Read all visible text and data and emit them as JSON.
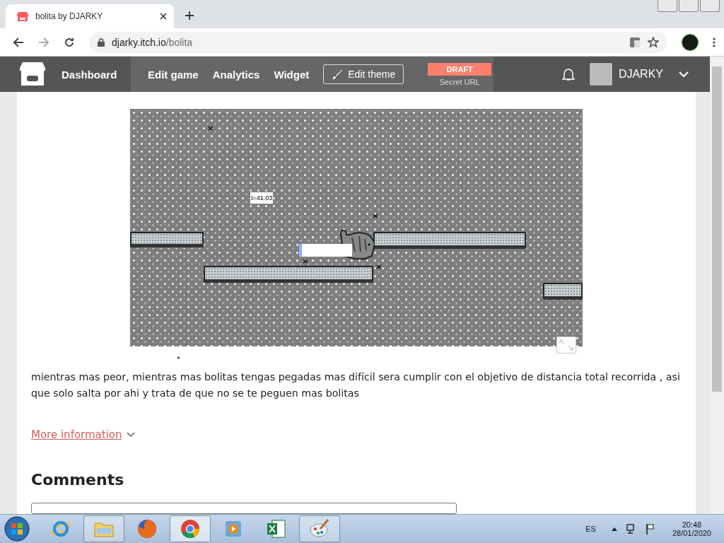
{
  "browser": {
    "tab_title": "bolita by DJARKY",
    "url_host": "djarky.itch.io",
    "url_path": "/bolita"
  },
  "itch_bar": {
    "dashboard": "Dashboard",
    "nav": [
      {
        "label": "Edit game"
      },
      {
        "label": "Analytics"
      },
      {
        "label": "Widget"
      }
    ],
    "edit_theme": "Edit theme",
    "draft": "DRAFT",
    "secret_url": "Secret URL",
    "username": "DJARKY"
  },
  "game": {
    "timer": "t=41.03"
  },
  "description": "mientras mas peor, mientras mas bolitas tengas pegadas mas difícil sera cumplir con el objetivo de distancia total recorrida , asi que solo salta por ahi y trata de que no se te peguen mas bolitas",
  "more_information": "More information",
  "comments_heading": "Comments",
  "taskbar": {
    "apps": [
      {
        "kind": "ie",
        "open": false
      },
      {
        "kind": "folder",
        "open": true
      },
      {
        "kind": "firefox",
        "open": false
      },
      {
        "kind": "chrome",
        "open": true,
        "selected": true
      },
      {
        "kind": "media",
        "open": false
      },
      {
        "kind": "excel",
        "open": false
      },
      {
        "kind": "paint",
        "open": true,
        "selected": false
      }
    ],
    "language": "ES",
    "time": "20:48",
    "date": "28/01/2020"
  }
}
